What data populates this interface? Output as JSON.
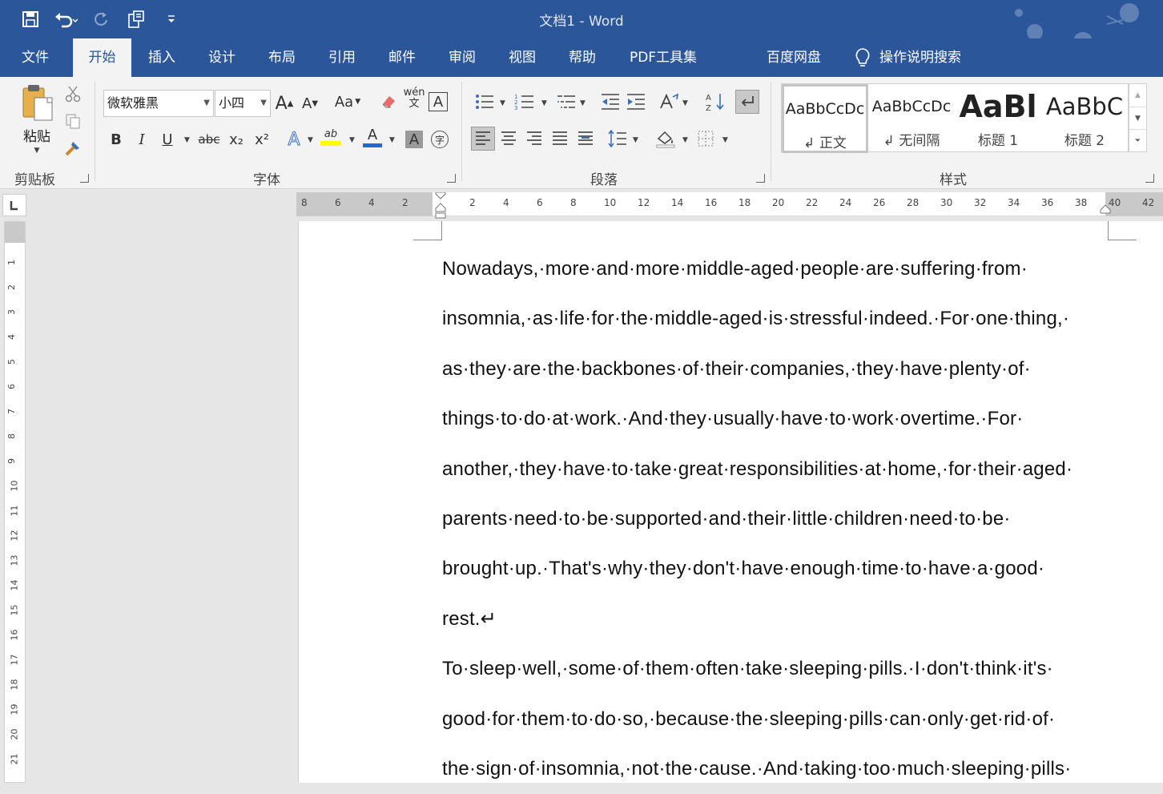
{
  "window": {
    "title": "文档1  -  Word"
  },
  "tabs": [
    "文件",
    "开始",
    "插入",
    "设计",
    "布局",
    "引用",
    "邮件",
    "审阅",
    "视图",
    "帮助",
    "PDF工具集",
    "百度网盘"
  ],
  "active_tab": "开始",
  "tell_me": "操作说明搜索",
  "clipboard": {
    "paste_label": "粘贴",
    "group_label": "剪贴板"
  },
  "font": {
    "name": "微软雅黑",
    "size": "小四",
    "group_label": "字体",
    "bold": "B",
    "italic": "I",
    "underline": "U",
    "strike": "abc",
    "subscript": "x₂",
    "superscript": "x²",
    "grow": "A",
    "shrink": "A",
    "change_case": "Aa",
    "phonetic": "wén\n文",
    "char_border": "A",
    "text_effect": "A",
    "highlight": "ab",
    "font_color": "A",
    "char_shading": "A",
    "enclose": "字"
  },
  "paragraph": {
    "group_label": "段落"
  },
  "styles": {
    "group_label": "样式",
    "items": [
      {
        "preview": "AaBbCcDc",
        "name": "↲ 正文"
      },
      {
        "preview": "AaBbCcDc",
        "name": "↲ 无间隔"
      },
      {
        "preview": "AaBl",
        "name": "标题 1"
      },
      {
        "preview": "AaBbC",
        "name": "标题 2"
      }
    ]
  },
  "ruler": {
    "h_ticks": [
      "8",
      "6",
      "4",
      "2",
      "",
      "2",
      "4",
      "6",
      "8",
      "10",
      "12",
      "14",
      "16",
      "18",
      "20",
      "22",
      "24",
      "26",
      "28",
      "30",
      "32",
      "34",
      "36",
      "38",
      "40",
      "42"
    ],
    "v_ticks": [
      "1",
      "2",
      "3",
      "4",
      "5",
      "6",
      "7",
      "8",
      "9",
      "10",
      "11",
      "12",
      "13",
      "14",
      "15",
      "16",
      "17",
      "18",
      "19",
      "20",
      "21"
    ]
  },
  "document": {
    "lines": [
      "Nowadays,·more·and·more·middle-aged·people·are·suffering·from·",
      "insomnia,·as·life·for·the·middle-aged·is·stressful·indeed.·For·one·thing,·",
      "as·they·are·the·backbones·of·their·companies,·they·have·plenty·of·",
      "things·to·do·at·work.·And·they·usually·have·to·work·overtime.·For·",
      "another,·they·have·to·take·great·responsibilities·at·home,·for·their·aged·",
      "parents·need·to·be·supported·and·their·little·children·need·to·be·",
      "brought·up.·That's·why·they·don't·have·enough·time·to·have·a·good·",
      "rest.↵",
      "To·sleep·well,·some·of·them·often·take·sleeping·pills.·I·don't·think·it's·",
      "good·for·them·to·do·so,·because·the·sleeping·pills·can·only·get·rid·of·",
      "the·sign·of·insomnia,·not·the·cause.·And·taking·too·much·sleeping·pills·"
    ]
  },
  "colors": {
    "brand": "#2b579a",
    "ribbon_bg": "#f3f3f3",
    "highlight": "#ffff00",
    "font_color": "#1f6bd0"
  }
}
